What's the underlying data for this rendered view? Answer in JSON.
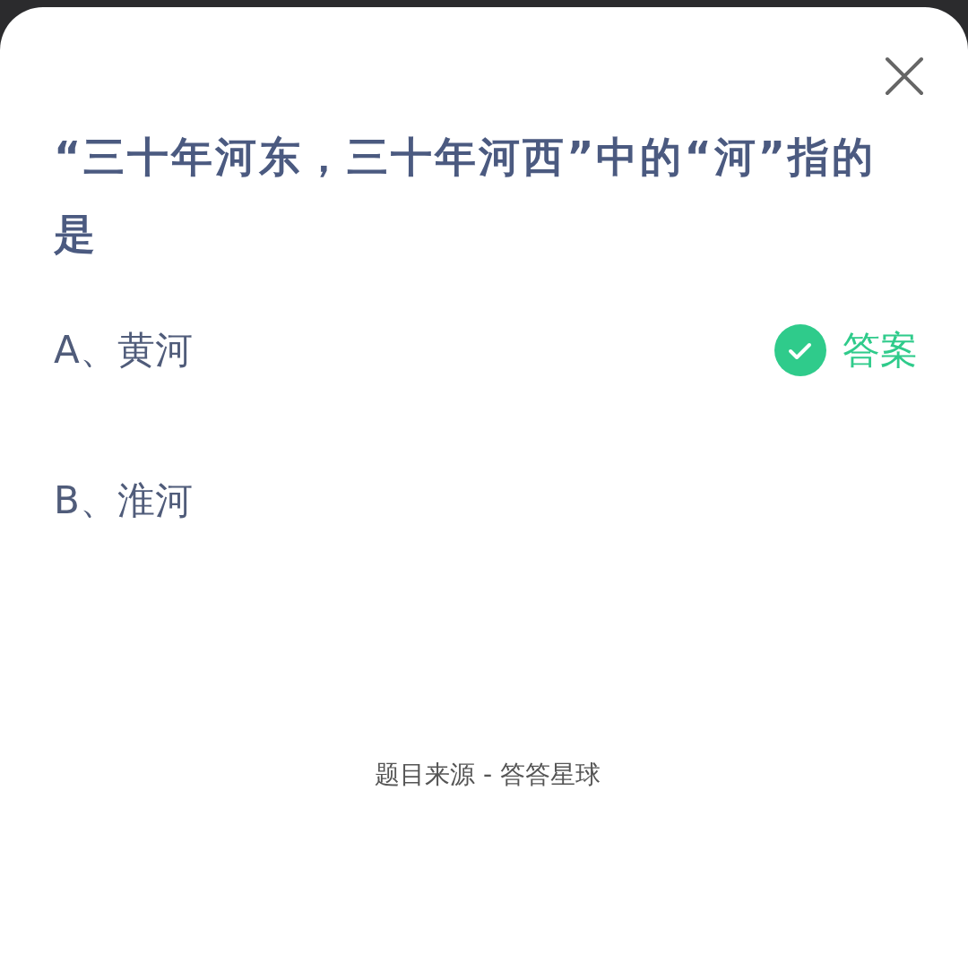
{
  "question": "“三十年河东，三十年河西”中的“河”指的是",
  "options": [
    {
      "text": "A、黄河",
      "correct": true,
      "badge": "答案"
    },
    {
      "text": "B、淮河",
      "correct": false
    }
  ],
  "footer": "题目来源 - 答答星球"
}
